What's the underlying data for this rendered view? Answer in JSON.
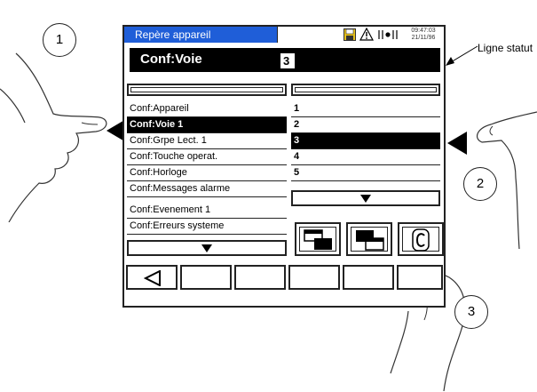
{
  "device": {
    "title": "Repère appareil",
    "status": {
      "time": "09:47:03",
      "date": "21/11/96",
      "icons": [
        "disk-icon",
        "warning-icon",
        "signal-icon"
      ]
    },
    "header": {
      "label": "Conf:Voie",
      "value": "3"
    },
    "menu_items": [
      "Conf:Appareil",
      "Conf:Voie 1",
      "Conf:Grpe Lect. 1",
      "Conf:Touche operat.",
      "Conf:Horloge",
      "Conf:Messages  alarme",
      "Conf:Evenement 1",
      "Conf:Erreurs  systeme"
    ],
    "selected_menu_index": 1,
    "value_items": [
      "1",
      "2",
      "3",
      "4",
      "5"
    ],
    "selected_value_index": 2,
    "action_buttons": [
      "page-copy-icon",
      "page-paste-icon",
      "copyright-c-icon"
    ],
    "softkeys": [
      "back-arrow",
      "",
      "",
      "",
      "",
      "",
      ""
    ]
  },
  "callouts": {
    "one": "1",
    "two": "2",
    "three": "3",
    "status_line": "Ligne statut"
  },
  "colors": {
    "title_bar": "#1f5ed8",
    "selection": "#000000"
  }
}
